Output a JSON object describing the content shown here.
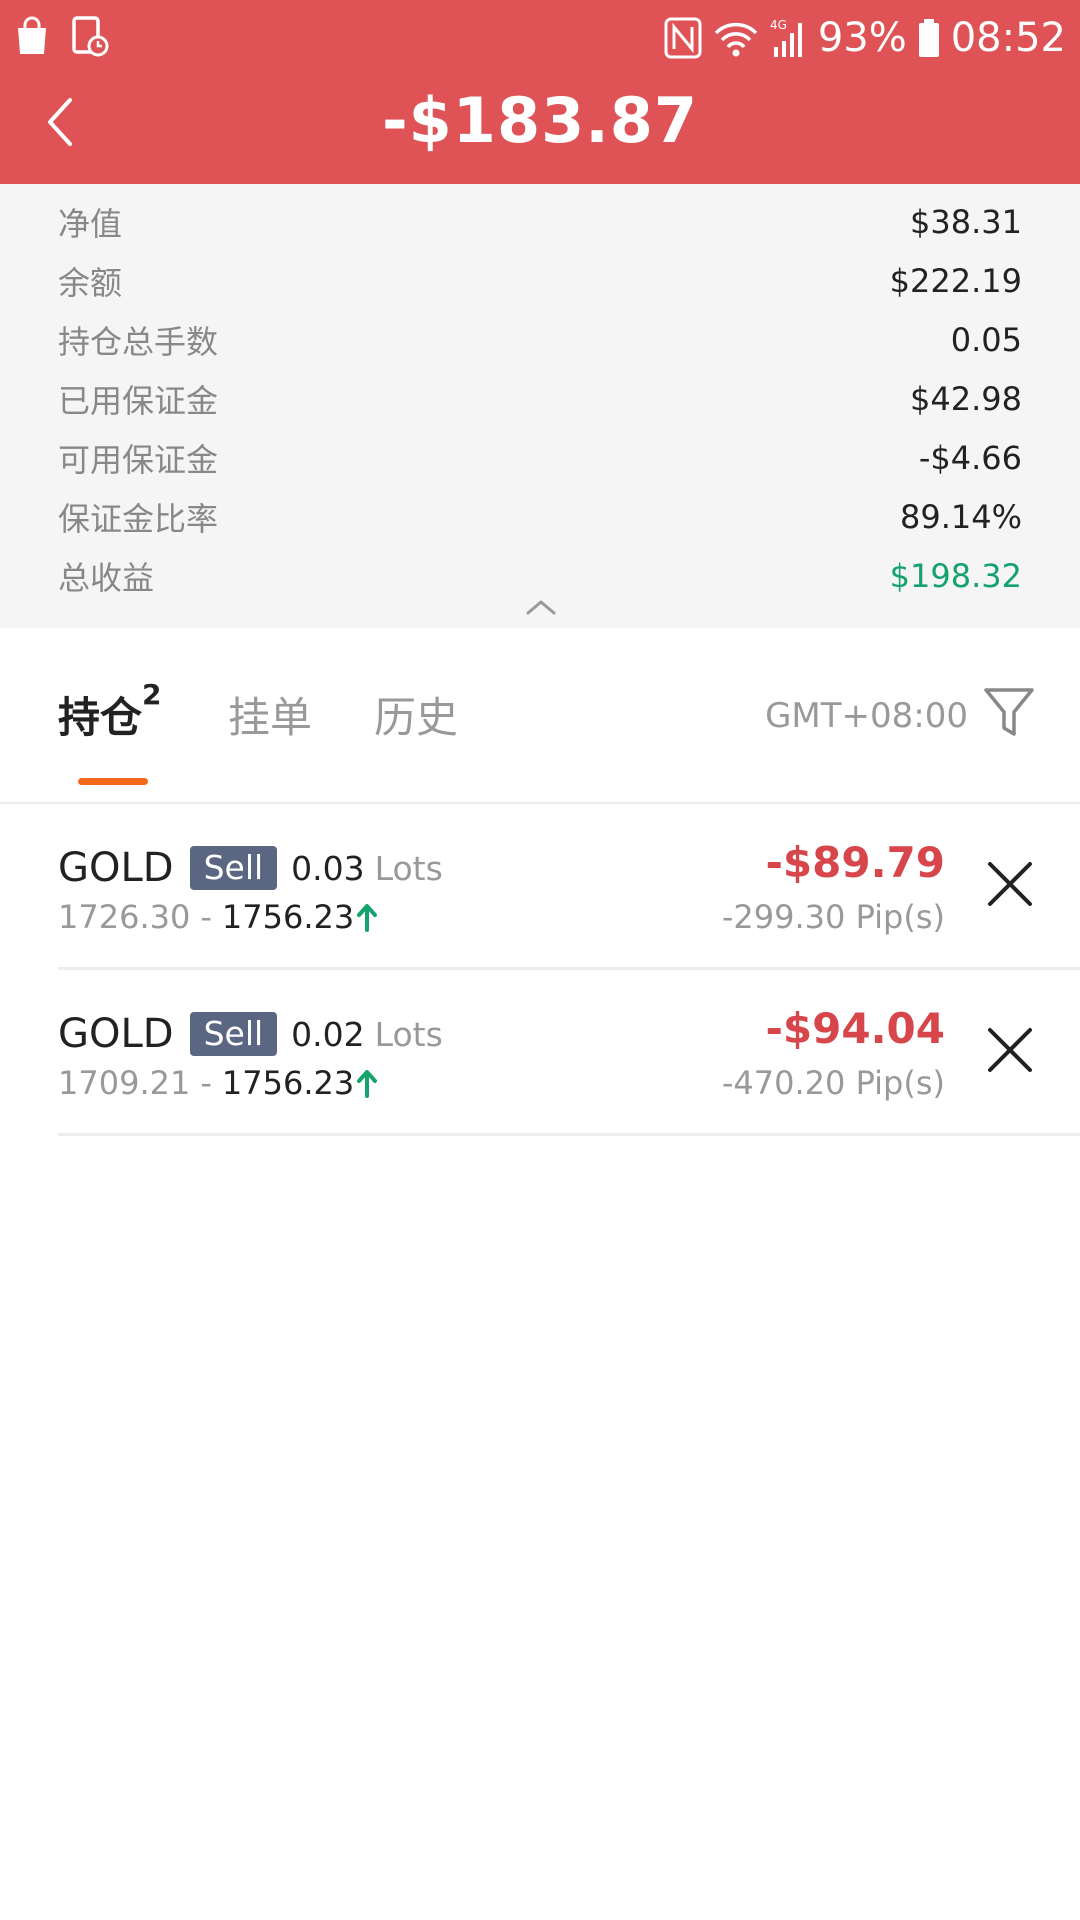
{
  "status_bar": {
    "battery": "93%",
    "time": "08:52"
  },
  "header": {
    "title": "-$183.87"
  },
  "summary": [
    {
      "label": "净值",
      "value": "$38.31"
    },
    {
      "label": "余额",
      "value": "$222.19"
    },
    {
      "label": "持仓总手数",
      "value": "0.05"
    },
    {
      "label": "已用保证金",
      "value": "$42.98"
    },
    {
      "label": "可用保证金",
      "value": "-$4.66"
    },
    {
      "label": "保证金比率",
      "value": "89.14%"
    },
    {
      "label": "总收益",
      "value": "$198.32"
    }
  ],
  "tabs": {
    "positions": "持仓",
    "positions_count": "2",
    "orders": "挂单",
    "history": "历史",
    "timezone": "GMT+08:00"
  },
  "positions": [
    {
      "symbol": "GOLD",
      "side": "Sell",
      "lots": "0.03",
      "lots_unit": "Lots",
      "open_price": "1726.30",
      "separator": "-",
      "current_price": "1756.23",
      "pnl": "-$89.79",
      "pips": "-299.30 Pip(s)"
    },
    {
      "symbol": "GOLD",
      "side": "Sell",
      "lots": "0.02",
      "lots_unit": "Lots",
      "open_price": "1709.21",
      "separator": "-",
      "current_price": "1756.23",
      "pnl": "-$94.04",
      "pips": "-470.20 Pip(s)"
    }
  ],
  "colors": {
    "header_bg": "#df5357",
    "positive": "#15a36d",
    "negative": "#d6464b",
    "tab_indicator": "#f26a1b",
    "sell_badge": "#5a6682"
  }
}
